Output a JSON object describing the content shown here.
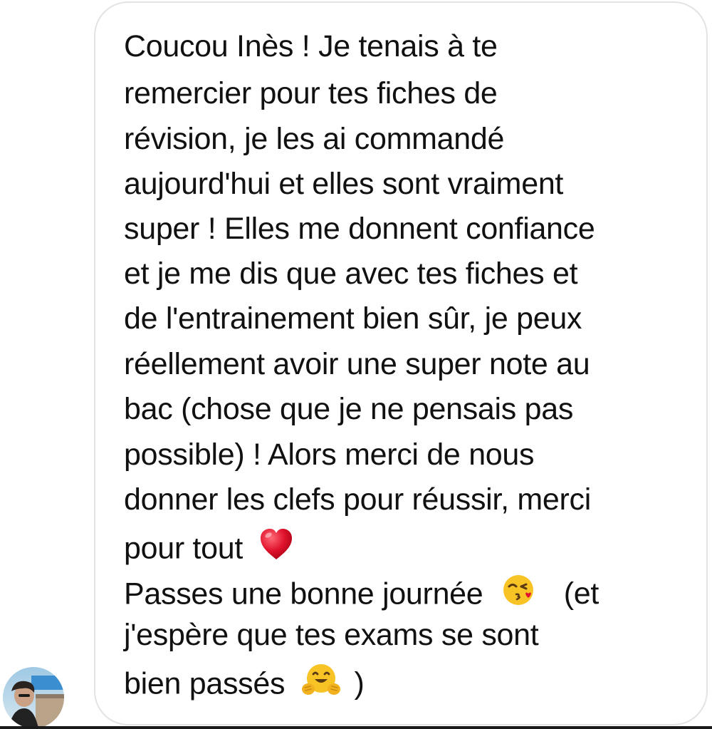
{
  "message": {
    "lines": [
      "Coucou Inès ! Je tenais à te",
      "remercier pour tes fiches de",
      "révision, je les ai commandé",
      "aujourd'hui et elles sont vraiment",
      "super ! Elles me donnent confiance",
      "et je me dis que avec tes fiches et",
      "de l'entrainement bien sûr, je peux",
      "réellement avoir une super note au",
      "bac (chose que je ne pensais pas",
      "possible) ! Alors merci de nous",
      "donner les clefs pour réussir, merci",
      "pour tout",
      "Passes une bonne journée",
      "(et",
      "j'espère que tes exams se sont",
      "bien passés",
      ")"
    ],
    "emojis": {
      "line12": "red-heart-icon",
      "line13": "face-blowing-kiss-icon",
      "line16": "hugging-face-icon"
    }
  },
  "sender": {
    "avatar": "sender-avatar-photo"
  },
  "colors": {
    "bubble_border": "#e3e3e3",
    "text": "#111111",
    "heart": "#e0142c",
    "emoji_face": "#f7c325"
  }
}
